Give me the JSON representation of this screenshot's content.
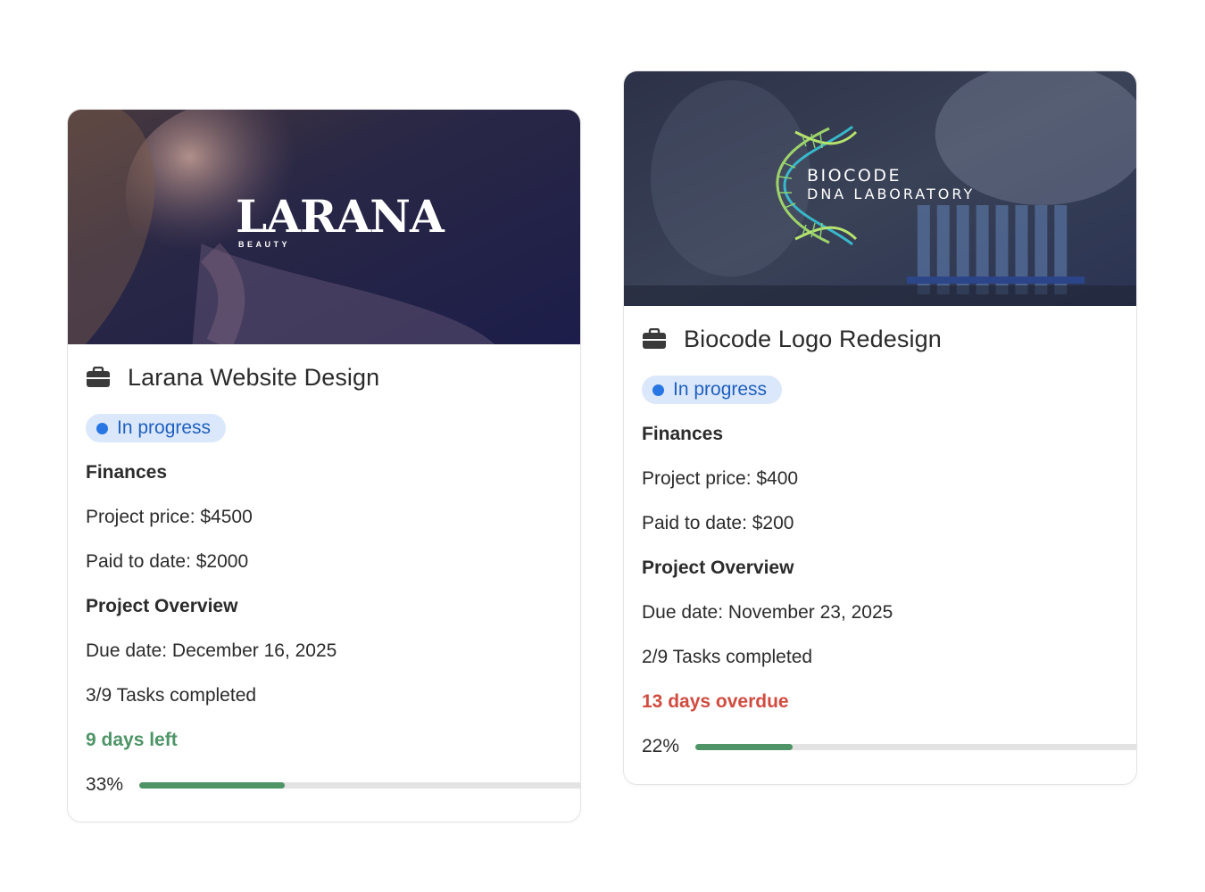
{
  "projects": [
    {
      "title": "Larana Website Design",
      "status": "In progress",
      "finances_heading": "Finances",
      "price": "Project price: $4500",
      "paid": "Paid to date: $2000",
      "overview_heading": "Project Overview",
      "due": "Due date: December 16, 2025",
      "tasks": "3/9 Tasks completed",
      "time_status": "9 days left",
      "progress_label": "33%",
      "progress": 0.33,
      "cover": {
        "logo": "LARANA",
        "sub": "BEAUTY"
      }
    },
    {
      "title": "Biocode Logo Redesign",
      "status": "In progress",
      "finances_heading": "Finances",
      "price": "Project price: $400",
      "paid": "Paid to date: $200",
      "overview_heading": "Project Overview",
      "due": "Due date: November 23, 2025",
      "tasks": "2/9 Tasks completed",
      "time_status": "13 days overdue",
      "progress_label": "22%",
      "progress": 0.22,
      "cover": {
        "logo_line1": "BIOCODE",
        "logo_line2": "DNA LABORATORY"
      }
    }
  ],
  "colors": {
    "accent_blue": "#2876e3",
    "badge_bg": "#dbe8fb",
    "good_green": "#4e9467",
    "overdue_red": "#d14b3f"
  },
  "icons": {
    "project": "briefcase-icon",
    "status": "dot-icon"
  }
}
